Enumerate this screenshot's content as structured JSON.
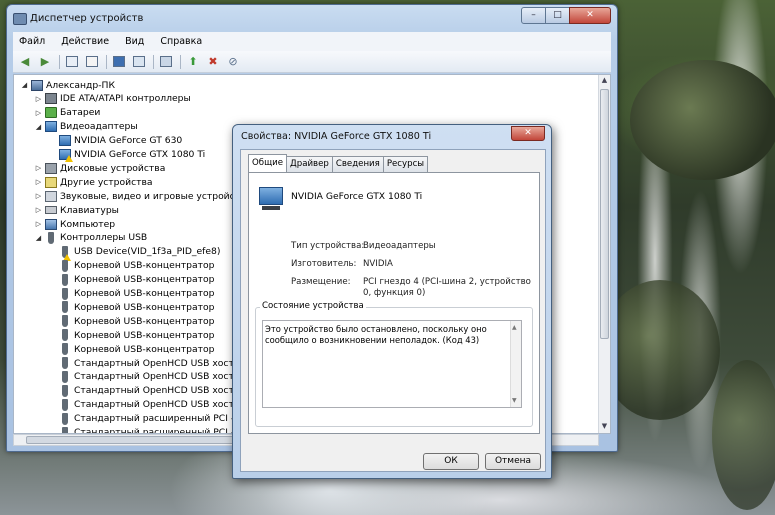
{
  "window": {
    "title": "Диспетчер устройств",
    "controls": {
      "minimize": "–",
      "maximize": "□",
      "close": "✕"
    }
  },
  "menu": [
    "Файл",
    "Действие",
    "Вид",
    "Справка"
  ],
  "toolbar_icons": [
    "back-arrow-icon",
    "forward-arrow-icon",
    "properties-view-icon",
    "show-hidden-icon",
    "help-icon",
    "device-props-icon",
    "scan-hardware-icon",
    "update-driver-icon",
    "disable-device-icon",
    "uninstall-device-icon"
  ],
  "tree": [
    {
      "label": "Александр-ПК",
      "indent": 0,
      "icon": "pc",
      "expanded": true
    },
    {
      "label": "IDE ATA/ATAPI контроллеры",
      "indent": 1,
      "icon": "ide"
    },
    {
      "label": "Батареи",
      "indent": 1,
      "icon": "bat"
    },
    {
      "label": "Видеоадаптеры",
      "indent": 1,
      "icon": "vid",
      "expanded": true
    },
    {
      "label": "NVIDIA GeForce GT 630",
      "indent": 2,
      "icon": "vid"
    },
    {
      "label": "NVIDIA GeForce GTX 1080 Ti",
      "indent": 2,
      "icon": "vid",
      "warning": true
    },
    {
      "label": "Дисковые устройства",
      "indent": 1,
      "icon": "disk"
    },
    {
      "label": "Другие устройства",
      "indent": 1,
      "icon": "other"
    },
    {
      "label": "Звуковые, видео и игровые устройства",
      "indent": 1,
      "icon": "snd"
    },
    {
      "label": "Клавиатуры",
      "indent": 1,
      "icon": "kbd"
    },
    {
      "label": "Компьютер",
      "indent": 1,
      "icon": "cmp"
    },
    {
      "label": "Контроллеры USB",
      "indent": 1,
      "icon": "usb",
      "expanded": true
    },
    {
      "label": "USB Device(VID_1f3a_PID_efe8)",
      "indent": 2,
      "icon": "usb",
      "warning": true
    },
    {
      "label": "Корневой USB-концентратор",
      "indent": 2,
      "icon": "usb"
    },
    {
      "label": "Корневой USB-концентратор",
      "indent": 2,
      "icon": "usb"
    },
    {
      "label": "Корневой USB-концентратор",
      "indent": 2,
      "icon": "usb"
    },
    {
      "label": "Корневой USB-концентратор",
      "indent": 2,
      "icon": "usb"
    },
    {
      "label": "Корневой USB-концентратор",
      "indent": 2,
      "icon": "usb"
    },
    {
      "label": "Корневой USB-концентратор",
      "indent": 2,
      "icon": "usb"
    },
    {
      "label": "Корневой USB-концентратор",
      "indent": 2,
      "icon": "usb"
    },
    {
      "label": "Стандартный OpenHCD USB хост-конт",
      "indent": 2,
      "icon": "usb"
    },
    {
      "label": "Стандартный OpenHCD USB хост-конт",
      "indent": 2,
      "icon": "usb"
    },
    {
      "label": "Стандартный OpenHCD USB хост-конт",
      "indent": 2,
      "icon": "usb"
    },
    {
      "label": "Стандартный OpenHCD USB хост-конт",
      "indent": 2,
      "icon": "usb"
    },
    {
      "label": "Стандартный расширенный PCI - USB",
      "indent": 2,
      "icon": "usb"
    },
    {
      "label": "Стандартный расширенный PCI - USB",
      "indent": 2,
      "icon": "usb"
    }
  ],
  "dialog": {
    "title": "Свойства: NVIDIA GeForce GTX 1080 Ti",
    "close": "✕",
    "tabs": [
      "Общие",
      "Драйвер",
      "Сведения",
      "Ресурсы"
    ],
    "active_tab": "Общие",
    "device_name": "NVIDIA GeForce GTX 1080 Ti",
    "props": {
      "type_label": "Тип устройства:",
      "type_value": "Видеоадаптеры",
      "maker_label": "Изготовитель:",
      "maker_value": "NVIDIA",
      "location_label": "Размещение:",
      "location_value": "PCI гнездо 4 (PCI-шина 2, устройство 0, функция 0)"
    },
    "status_group_label": "Состояние устройства",
    "status_text": "Это устройство было остановлено, поскольку оно сообщило о возникновении неполадок. (Код 43)",
    "ok": "ОК",
    "cancel": "Отмена"
  },
  "colors": {
    "warning": "#f2c200",
    "titlebar": "#b6cde8"
  }
}
